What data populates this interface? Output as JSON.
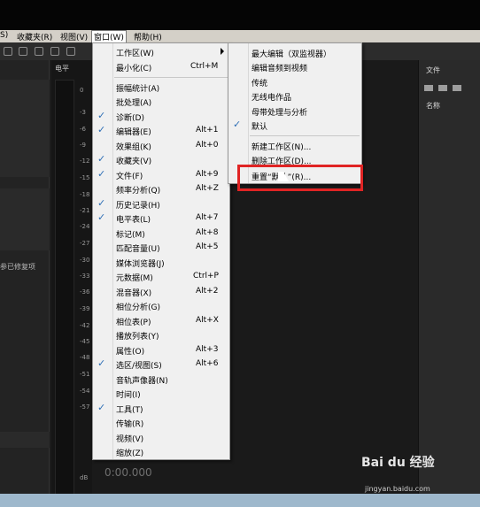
{
  "menubar": {
    "items": [
      "S)",
      "收藏夹(R)",
      "视图(V)",
      "窗口(W)",
      "帮助(H)"
    ]
  },
  "left_panel": {
    "label": "参已修复项"
  },
  "meter": {
    "label": "电平",
    "ticks": [
      "0",
      "-3",
      "-6",
      "-9",
      "-12",
      "-15",
      "-18",
      "-21",
      "-24",
      "-27",
      "-30",
      "-33",
      "-36",
      "-39",
      "-42",
      "-45",
      "-48",
      "-51",
      "-54",
      "-57",
      "dB"
    ]
  },
  "editor": {
    "timecode": "0:00.000"
  },
  "right_panel": {
    "title": "文件",
    "name_header": "名称"
  },
  "window_menu": {
    "items": [
      {
        "label": "工作区(W)",
        "shortcut": "",
        "checked": false,
        "submenu": true
      },
      {
        "label": "最小化(C)",
        "shortcut": "Ctrl+M",
        "checked": false
      },
      {
        "label": "振幅统计(A)",
        "shortcut": "",
        "checked": false
      },
      {
        "label": "批处理(A)",
        "shortcut": "",
        "checked": false
      },
      {
        "label": "诊断(D)",
        "shortcut": "",
        "checked": true
      },
      {
        "label": "编辑器(E)",
        "shortcut": "Alt+1",
        "checked": true
      },
      {
        "label": "效果组(K)",
        "shortcut": "Alt+0",
        "checked": false
      },
      {
        "label": "收藏夹(V)",
        "shortcut": "",
        "checked": true
      },
      {
        "label": "文件(F)",
        "shortcut": "Alt+9",
        "checked": true
      },
      {
        "label": "频率分析(Q)",
        "shortcut": "Alt+Z",
        "checked": false
      },
      {
        "label": "历史记录(H)",
        "shortcut": "",
        "checked": true
      },
      {
        "label": "电平表(L)",
        "shortcut": "Alt+7",
        "checked": true
      },
      {
        "label": "标记(M)",
        "shortcut": "Alt+8",
        "checked": false
      },
      {
        "label": "匹配音量(U)",
        "shortcut": "Alt+5",
        "checked": false
      },
      {
        "label": "媒体浏览器(J)",
        "shortcut": "",
        "checked": false
      },
      {
        "label": "元数据(M)",
        "shortcut": "Ctrl+P",
        "checked": false
      },
      {
        "label": "混音器(X)",
        "shortcut": "Alt+2",
        "checked": false
      },
      {
        "label": "相位分析(G)",
        "shortcut": "",
        "checked": false
      },
      {
        "label": "相位表(P)",
        "shortcut": "Alt+X",
        "checked": false
      },
      {
        "label": "播放列表(Y)",
        "shortcut": "",
        "checked": false
      },
      {
        "label": "属性(O)",
        "shortcut": "Alt+3",
        "checked": false
      },
      {
        "label": "选区/视图(S)",
        "shortcut": "Alt+6",
        "checked": true
      },
      {
        "label": "音轨声像器(N)",
        "shortcut": "",
        "checked": false
      },
      {
        "label": "时间(I)",
        "shortcut": "",
        "checked": false
      },
      {
        "label": "工具(T)",
        "shortcut": "",
        "checked": true
      },
      {
        "label": "传输(R)",
        "shortcut": "",
        "checked": false
      },
      {
        "label": "视频(V)",
        "shortcut": "",
        "checked": false
      },
      {
        "label": "缩放(Z)",
        "shortcut": "",
        "checked": false
      }
    ]
  },
  "workspace_submenu": {
    "items": [
      {
        "label": "最大编辑（双监视器）",
        "checked": false
      },
      {
        "label": "编辑音频到视频",
        "checked": false
      },
      {
        "label": "传统",
        "checked": false
      },
      {
        "label": "无线电作品",
        "checked": false
      },
      {
        "label": "母带处理与分析",
        "checked": false
      },
      {
        "label": "默认",
        "checked": true
      },
      {
        "label": "新建工作区(N)...",
        "checked": false
      },
      {
        "label": "删除工作区(D)...",
        "checked": false
      },
      {
        "label": "重置“默认”(R)...",
        "checked": false
      }
    ]
  },
  "watermark": {
    "brand": "Bai du 经验",
    "url": "jingyan.baidu.com"
  },
  "colors": {
    "check": "#2f6fb6",
    "highlight": "#e02424"
  }
}
